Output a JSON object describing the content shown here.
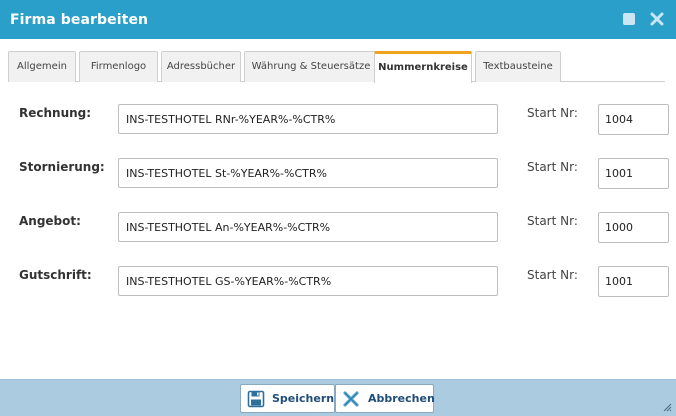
{
  "window": {
    "title": "Firma bearbeiten"
  },
  "tabs": [
    {
      "label": "Allgemein"
    },
    {
      "label": "Firmenlogo"
    },
    {
      "label": "Adressbücher"
    },
    {
      "label": "Währung & Steuersätze"
    },
    {
      "label": "Nummernkreise"
    },
    {
      "label": "Textbausteine"
    }
  ],
  "active_tab": "Nummernkreise",
  "rows": [
    {
      "label": "Rechnung:",
      "pattern": "INS-TESTHOTEL RNr-%YEAR%-%CTR%",
      "start_label": "Start Nr:",
      "start": "1004"
    },
    {
      "label": "Stornierung:",
      "pattern": "INS-TESTHOTEL St-%YEAR%-%CTR%",
      "start_label": "Start Nr:",
      "start": "1001"
    },
    {
      "label": "Angebot:",
      "pattern": "INS-TESTHOTEL An-%YEAR%-%CTR%",
      "start_label": "Start Nr:",
      "start": "1000"
    },
    {
      "label": "Gutschrift:",
      "pattern": "INS-TESTHOTEL GS-%YEAR%-%CTR%",
      "start_label": "Start Nr:",
      "start": "1001"
    }
  ],
  "footer": {
    "save_label": "Speichern",
    "cancel_label": "Abbrechen"
  },
  "colors": {
    "titlebar": "#2a9fc9",
    "active_tab_accent": "#f0a31c",
    "footer": "#aacbe0",
    "button_text": "#1f4e79"
  },
  "icons": {
    "maximize": "square-icon",
    "close": "close-icon",
    "save": "floppy-disk-icon",
    "cancel": "close-icon",
    "resize": "resize-grip-icon"
  }
}
